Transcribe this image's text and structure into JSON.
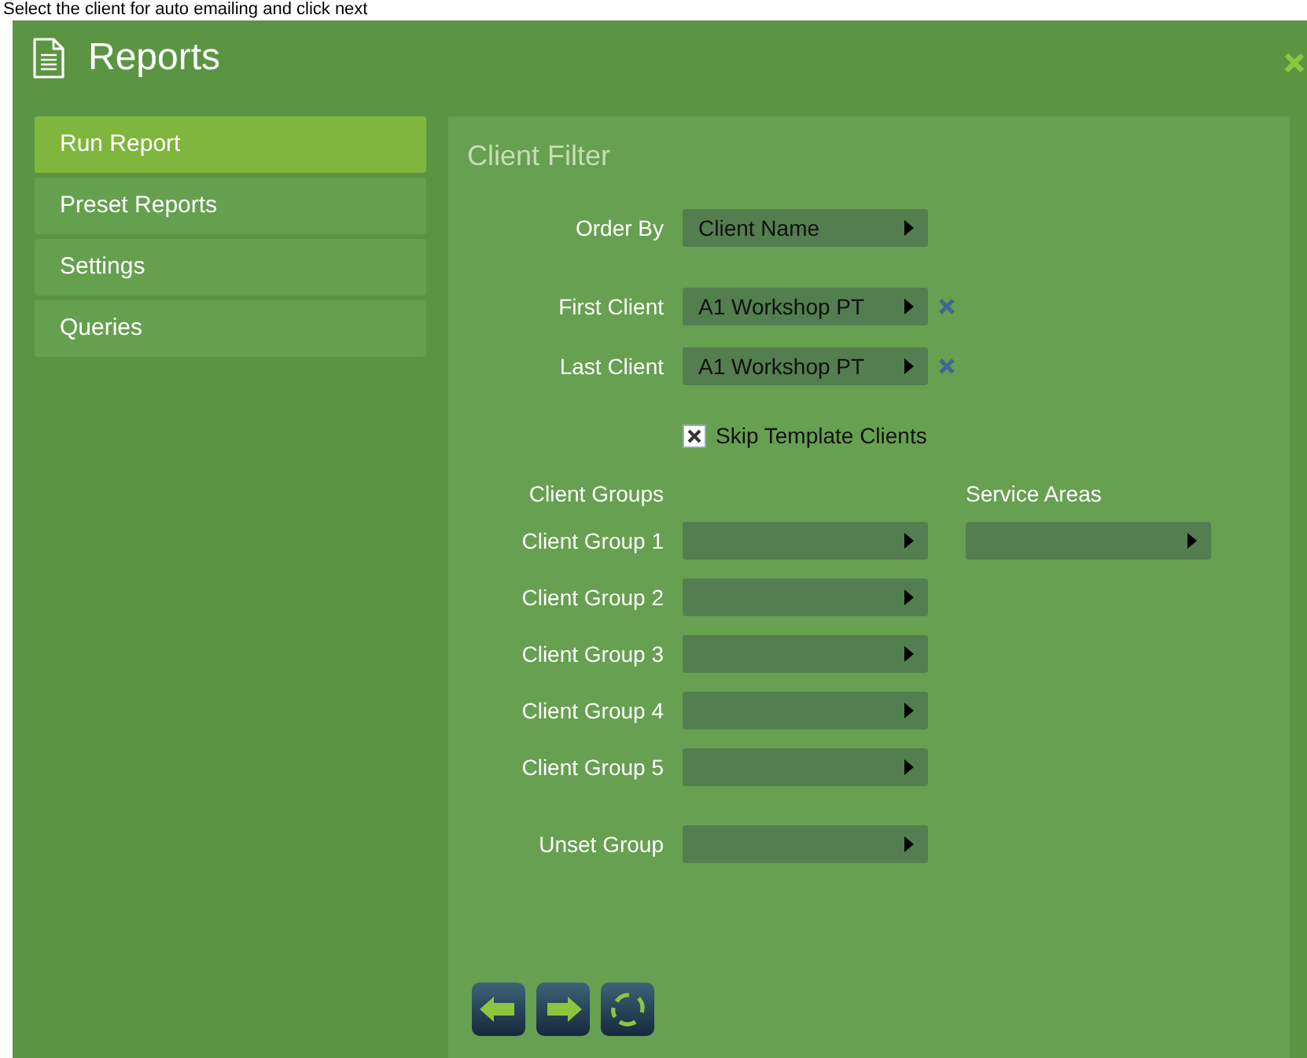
{
  "caption": "Select the client for auto emailing and click next",
  "window": {
    "title": "Reports"
  },
  "sidebar": {
    "items": [
      {
        "label": "Run Report",
        "selected": true
      },
      {
        "label": "Preset Reports",
        "selected": false
      },
      {
        "label": "Settings",
        "selected": false
      },
      {
        "label": "Queries",
        "selected": false
      }
    ]
  },
  "panel": {
    "title": "Client Filter",
    "order_by": {
      "label": "Order By",
      "value": "Client Name"
    },
    "client_range": [
      {
        "label": "First Client",
        "value": "A1 Workshop PT"
      },
      {
        "label": "Last Client",
        "value": "A1 Workshop PT"
      }
    ],
    "skip_template_clients": {
      "label": "Skip Template Clients",
      "checked": true
    },
    "client_groups": {
      "heading": "Client Groups",
      "groups": [
        {
          "label": "Client Group 1"
        },
        {
          "label": "Client Group 2"
        },
        {
          "label": "Client Group 3"
        },
        {
          "label": "Client Group 4"
        },
        {
          "label": "Client Group 5"
        }
      ]
    },
    "service_areas": {
      "heading": "Service Areas"
    },
    "unset_group": {
      "label": "Unset Group"
    }
  }
}
